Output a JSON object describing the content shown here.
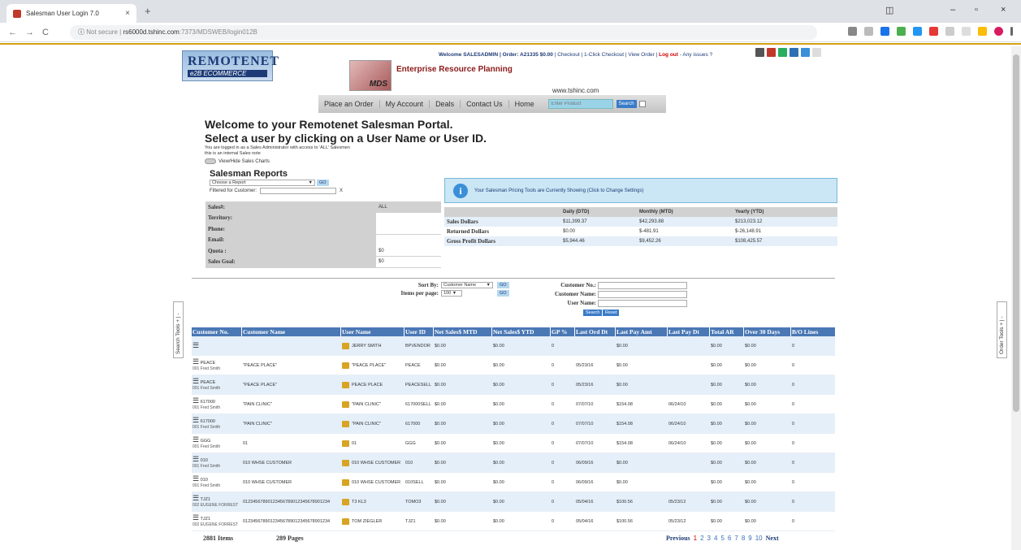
{
  "browser": {
    "tab_title": "Salesman User Login 7.0",
    "tab_close": "×",
    "new_tab": "+",
    "url_secure": "Not secure",
    "url_host": "rs6000d.tshinc.com",
    "url_rest": ":7373/MDSWEB/login012B",
    "nav_back": "←",
    "nav_forward": "→",
    "nav_reload": "C",
    "info_icon": "ⓘ",
    "window_min": "–",
    "window_max": "▫",
    "window_close": "×"
  },
  "header": {
    "logo_line1": "REMOTENET",
    "logo_line2": "e2B ECOMMERCE",
    "mds_label": "MDS",
    "erp_title": "Enterprise Resource Planning",
    "site": "www.tshinc.com",
    "welcome_prefix": "Welcome SALESADMIN | Order: A21335 $0.00",
    "welcome_links": "| Checkout | 1-Click Checkout | View Order |",
    "logout": "Log out",
    "issues": "- Any issues ?"
  },
  "nav": {
    "items": [
      "Place an Order",
      "My Account",
      "Deals",
      "Contact Us",
      "Home"
    ],
    "product_placeholder": "Enter Product",
    "search_button": "Search"
  },
  "intro": {
    "line1": "Welcome to your Remotenet Salesman Portal.",
    "line2": "Select a user by clicking on a User Name or User ID.",
    "note1": "You are logged in as a Sales Administrator with access to 'ALL' Salesmen",
    "note2": "this is an internal Sales note",
    "toggle_label": "View/Hide Sales Charts"
  },
  "reports": {
    "title": "Salesman Reports",
    "select": "Choose a Report",
    "go": "GO",
    "filter_label": "Filtered for Customer:",
    "filter_clear": "X"
  },
  "info": [
    {
      "label": "Sales#:",
      "value": "ALL"
    },
    {
      "label": "Territory:",
      "value": ""
    },
    {
      "label": "Phone:",
      "value": ""
    },
    {
      "label": "Email:",
      "value": ""
    },
    {
      "label": "Quota :",
      "value": "$0"
    },
    {
      "label": "Sales Goal:",
      "value": "$0"
    }
  ],
  "pricing_msg": "Your Salesman Pricing Tools are Currently Showing (Click to Change Settings)",
  "sales": {
    "headers": [
      "",
      "Daily (DTD)",
      "Monthly (MTD)",
      "Yearly (YTD)"
    ],
    "rows": [
      [
        "Sales Dollars",
        "$11,399.37",
        "$42,293.88",
        "$213,023.12"
      ],
      [
        "Returned Dollars",
        "$0.00",
        "$-481.91",
        "$-26,148.91"
      ],
      [
        "Gross Profit Dollars",
        "$5,944.46",
        "$9,452.26",
        "$108,425.57"
      ]
    ]
  },
  "filters": {
    "sort_by_label": "Sort By:",
    "sort_by_value": "Customer Name",
    "items_label": "Items per page:",
    "items_value": "100",
    "go": "GO",
    "cust_no_label": "Customer No.:",
    "cust_name_label": "Customer Name:",
    "user_name_label": "User Name:",
    "search_btn": "Search",
    "reset_btn": "Reset"
  },
  "side": {
    "left": "Search Tools + | -",
    "right": "Order Tools + | -"
  },
  "table": {
    "headers": [
      "Customer No.",
      "Customer Name",
      "User Name",
      "User ID",
      "Net Sales$ MTD",
      "Net Sales$ YTD",
      "GP %",
      "Last Ord Dt",
      "Last Pay Amt",
      "Last Pay Dt",
      "Total AR",
      "Over 30 Days",
      "B/O Lines"
    ],
    "rows": [
      {
        "cust": "",
        "sub": "",
        "name": "",
        "user": "JERRY SMITH",
        "uid": "BPVENDOR",
        "mtd": "$0.00",
        "ytd": "$0.00",
        "gp": "0",
        "lod": "",
        "lpa": "$0.00",
        "lpd": "",
        "ar": "$0.00",
        "o30": "$0.00",
        "bo": "0"
      },
      {
        "cust": "PEACE",
        "sub": "001 Fred Smith",
        "name": "\"PEACE PLACE\"",
        "user": "\"PEACE PLACE\"",
        "uid": "PEACE",
        "mtd": "$0.00",
        "ytd": "$0.00",
        "gp": "0",
        "lod": "05/23/16",
        "lpa": "$0.00",
        "lpd": "",
        "ar": "$0.00",
        "o30": "$0.00",
        "bo": "0"
      },
      {
        "cust": "PEACE",
        "sub": "001 Fred Smith",
        "name": "\"PEACE PLACE\"",
        "user": "PEACE PLACE",
        "uid": "PEACESELL",
        "mtd": "$0.00",
        "ytd": "$0.00",
        "gp": "0",
        "lod": "05/23/16",
        "lpa": "$0.00",
        "lpd": "",
        "ar": "$0.00",
        "o30": "$0.00",
        "bo": "0"
      },
      {
        "cust": "617000",
        "sub": "001 Fred Smith",
        "name": "\"PAIN CLINIC\"",
        "user": "\"PAIN CLINIC\"",
        "uid": "617000SELL",
        "mtd": "$0.00",
        "ytd": "$0.00",
        "gp": "0",
        "lod": "07/07/10",
        "lpa": "$154.08",
        "lpd": "06/24/10",
        "ar": "$0.00",
        "o30": "$0.00",
        "bo": "0"
      },
      {
        "cust": "617000",
        "sub": "001 Fred Smith",
        "name": "\"PAIN CLINIC\"",
        "user": "\"PAIN CLINIC\"",
        "uid": "617000",
        "mtd": "$0.00",
        "ytd": "$0.00",
        "gp": "0",
        "lod": "07/07/10",
        "lpa": "$154.08",
        "lpd": "06/24/10",
        "ar": "$0.00",
        "o30": "$0.00",
        "bo": "0"
      },
      {
        "cust": "GGG",
        "sub": "001 Fred Smith",
        "name": "01",
        "user": "01",
        "uid": "GGG",
        "mtd": "$0.00",
        "ytd": "$0.00",
        "gp": "0",
        "lod": "07/07/10",
        "lpa": "$154.08",
        "lpd": "06/24/10",
        "ar": "$0.00",
        "o30": "$0.00",
        "bo": "0"
      },
      {
        "cust": "010",
        "sub": "001 Fred Smith",
        "name": "010 WHSE CUSTOMER",
        "user": "010 WHSE CUSTOMER",
        "uid": "010",
        "mtd": "$0.00",
        "ytd": "$0.00",
        "gp": "0",
        "lod": "06/09/16",
        "lpa": "$0.00",
        "lpd": "",
        "ar": "$0.00",
        "o30": "$0.00",
        "bo": "0"
      },
      {
        "cust": "010",
        "sub": "001 Fred Smith",
        "name": "010 WHSE CUSTOMER",
        "user": "010 WHSE CUSTOMER",
        "uid": "010SELL",
        "mtd": "$0.00",
        "ytd": "$0.00",
        "gp": "0",
        "lod": "06/09/16",
        "lpa": "$0.00",
        "lpd": "",
        "ar": "$0.00",
        "o30": "$0.00",
        "bo": "0"
      },
      {
        "cust": "TJZ1",
        "sub": "002 EUGENE FORREST",
        "name": "01234567890123456789012345678901234",
        "user": "T3 KL3",
        "uid": "TOMO3",
        "mtd": "$0.00",
        "ytd": "$0.00",
        "gp": "0",
        "lod": "05/04/16",
        "lpa": "$100.56",
        "lpd": "05/23/12",
        "ar": "$0.00",
        "o30": "$0.00",
        "bo": "0"
      },
      {
        "cust": "TJZ1",
        "sub": "002 EUGENE FORREST",
        "name": "01234567890123456789012345678901234",
        "user": "TOM ZIEGLER",
        "uid": "TJZ1",
        "mtd": "$0.00",
        "ytd": "$0.00",
        "gp": "0",
        "lod": "05/04/16",
        "lpa": "$100.56",
        "lpd": "05/23/12",
        "ar": "$0.00",
        "o30": "$0.00",
        "bo": "0"
      }
    ]
  },
  "footer": {
    "items": "2881 Items",
    "pages": "289 Pages",
    "previous": "Previous",
    "page_nums": [
      "1",
      "2",
      "3",
      "4",
      "5",
      "6",
      "7",
      "8",
      "9",
      "10"
    ],
    "next": "Next"
  },
  "colors": {
    "header_blue": "#4a78b5",
    "row_alt": "#e4eff9",
    "logout_red": "#cc0000",
    "accent_gold": "#d4a017"
  }
}
